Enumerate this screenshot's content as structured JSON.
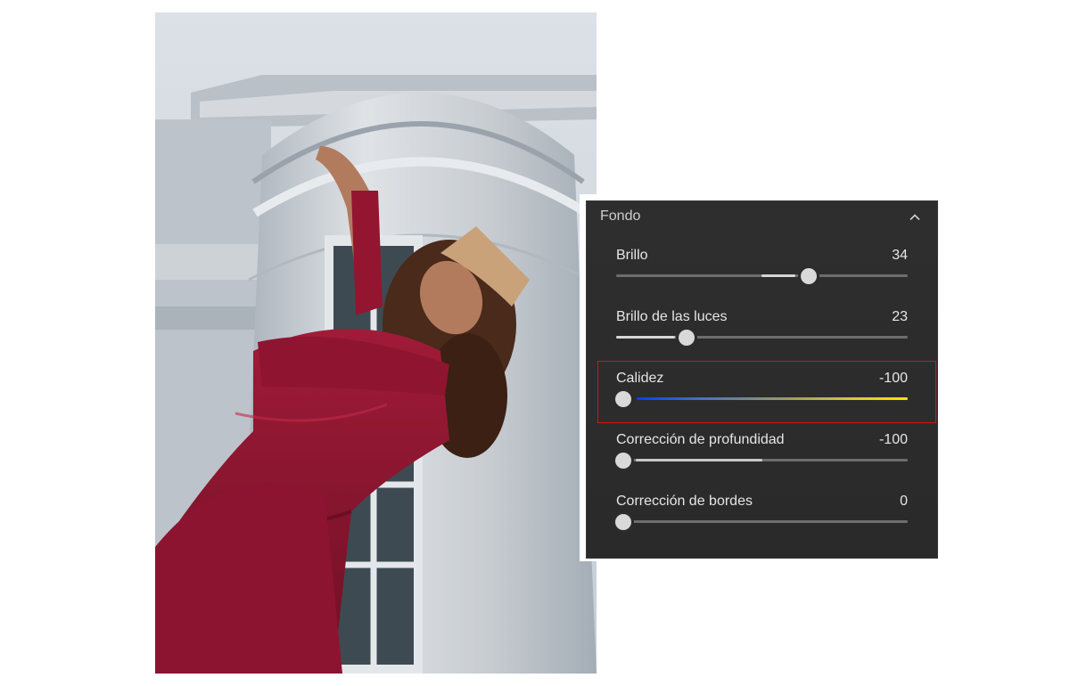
{
  "panel": {
    "title": "Fondo",
    "collapse_icon": "chevron-up-icon",
    "sliders": [
      {
        "id": "brillo",
        "label": "Brillo",
        "value": "34",
        "min": -100,
        "max": 100,
        "numeric": 34,
        "track": "neutral"
      },
      {
        "id": "brillo-luces",
        "label": "Brillo de las luces",
        "value": "23",
        "min": -100,
        "max": 100,
        "numeric": 23,
        "track": "neutral"
      },
      {
        "id": "calidez",
        "label": "Calidez",
        "value": "-100",
        "min": -100,
        "max": 100,
        "numeric": -100,
        "track": "blue-to-yellow",
        "highlighted": true
      },
      {
        "id": "profundidad",
        "label": "Corrección de profundidad",
        "value": "-100",
        "min": -100,
        "max": 100,
        "numeric": -100,
        "track": "neutral"
      },
      {
        "id": "bordes",
        "label": "Corrección de bordes",
        "value": "0",
        "min": 0,
        "max": 100,
        "numeric": 0,
        "track": "neutral"
      }
    ]
  },
  "colors": {
    "panel_bg": "#2d2d2d",
    "text": "#e6e6e6",
    "highlight": "#d01616",
    "gradient_start": "#0a3cff",
    "gradient_end": "#ffe100",
    "dress": "#8e1530"
  }
}
